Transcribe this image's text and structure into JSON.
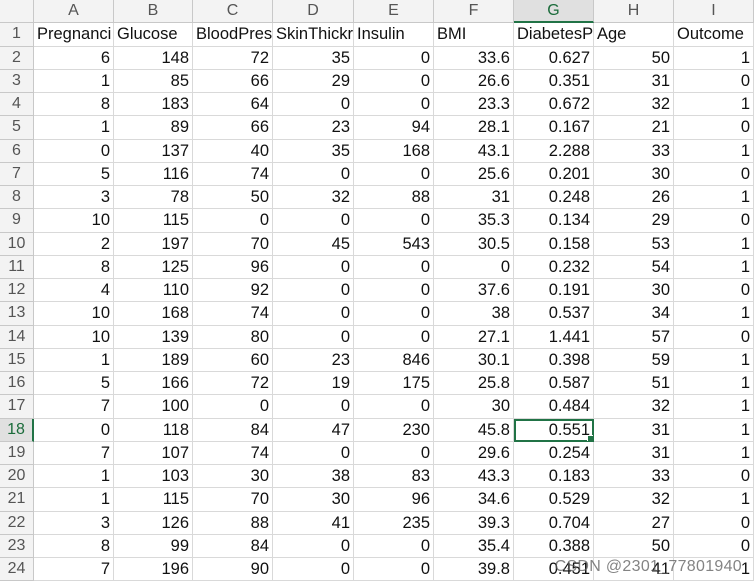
{
  "sheet": {
    "column_letters": [
      "A",
      "B",
      "C",
      "D",
      "E",
      "F",
      "G",
      "H",
      "I"
    ],
    "active_column": "G",
    "active_row": 18,
    "headers": [
      "Pregnanci",
      "Glucose",
      "BloodPres",
      "SkinThickr",
      "Insulin",
      "BMI",
      "DiabetesP",
      "Age",
      "Outcome"
    ],
    "rows": [
      [
        "6",
        "148",
        "72",
        "35",
        "0",
        "33.6",
        "0.627",
        "50",
        "1"
      ],
      [
        "1",
        "85",
        "66",
        "29",
        "0",
        "26.6",
        "0.351",
        "31",
        "0"
      ],
      [
        "8",
        "183",
        "64",
        "0",
        "0",
        "23.3",
        "0.672",
        "32",
        "1"
      ],
      [
        "1",
        "89",
        "66",
        "23",
        "94",
        "28.1",
        "0.167",
        "21",
        "0"
      ],
      [
        "0",
        "137",
        "40",
        "35",
        "168",
        "43.1",
        "2.288",
        "33",
        "1"
      ],
      [
        "5",
        "116",
        "74",
        "0",
        "0",
        "25.6",
        "0.201",
        "30",
        "0"
      ],
      [
        "3",
        "78",
        "50",
        "32",
        "88",
        "31",
        "0.248",
        "26",
        "1"
      ],
      [
        "10",
        "115",
        "0",
        "0",
        "0",
        "35.3",
        "0.134",
        "29",
        "0"
      ],
      [
        "2",
        "197",
        "70",
        "45",
        "543",
        "30.5",
        "0.158",
        "53",
        "1"
      ],
      [
        "8",
        "125",
        "96",
        "0",
        "0",
        "0",
        "0.232",
        "54",
        "1"
      ],
      [
        "4",
        "110",
        "92",
        "0",
        "0",
        "37.6",
        "0.191",
        "30",
        "0"
      ],
      [
        "10",
        "168",
        "74",
        "0",
        "0",
        "38",
        "0.537",
        "34",
        "1"
      ],
      [
        "10",
        "139",
        "80",
        "0",
        "0",
        "27.1",
        "1.441",
        "57",
        "0"
      ],
      [
        "1",
        "189",
        "60",
        "23",
        "846",
        "30.1",
        "0.398",
        "59",
        "1"
      ],
      [
        "5",
        "166",
        "72",
        "19",
        "175",
        "25.8",
        "0.587",
        "51",
        "1"
      ],
      [
        "7",
        "100",
        "0",
        "0",
        "0",
        "30",
        "0.484",
        "32",
        "1"
      ],
      [
        "0",
        "118",
        "84",
        "47",
        "230",
        "45.8",
        "0.551",
        "31",
        "1"
      ],
      [
        "7",
        "107",
        "74",
        "0",
        "0",
        "29.6",
        "0.254",
        "31",
        "1"
      ],
      [
        "1",
        "103",
        "30",
        "38",
        "83",
        "43.3",
        "0.183",
        "33",
        "0"
      ],
      [
        "1",
        "115",
        "70",
        "30",
        "96",
        "34.6",
        "0.529",
        "32",
        "1"
      ],
      [
        "3",
        "126",
        "88",
        "41",
        "235",
        "39.3",
        "0.704",
        "27",
        "0"
      ],
      [
        "8",
        "99",
        "84",
        "0",
        "0",
        "35.4",
        "0.388",
        "50",
        "0"
      ],
      [
        "7",
        "196",
        "90",
        "0",
        "0",
        "39.8",
        "0.451",
        "41",
        "1"
      ]
    ]
  },
  "watermark": "CSDN @2301_77801940",
  "colors": {
    "grid": "#d9d9d9",
    "header_bg": "#f3f3f3",
    "selection": "#217346"
  }
}
